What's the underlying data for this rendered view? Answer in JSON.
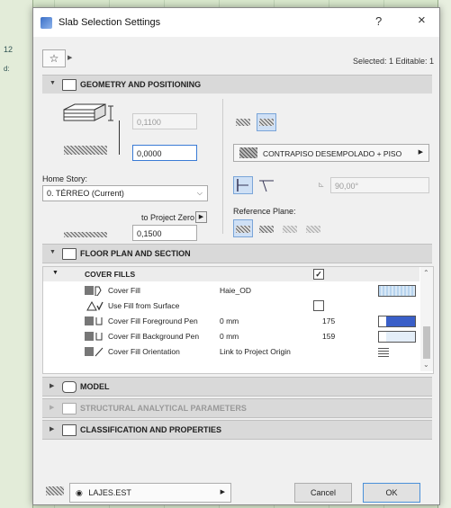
{
  "window": {
    "title": "Slab Selection Settings",
    "help": "?",
    "close": "×"
  },
  "toolbar": {
    "selected_text": "Selected: 1 Editable: 1"
  },
  "sections": {
    "geometry": "GEOMETRY AND POSITIONING",
    "floorplan": "FLOOR PLAN AND SECTION",
    "model": "MODEL",
    "structural": "STRUCTURAL ANALYTICAL PARAMETERS",
    "classification": "CLASSIFICATION AND PROPERTIES"
  },
  "geometry": {
    "thickness": "0,1100",
    "offset": "0,0000",
    "home_story_label": "Home Story:",
    "home_story": "0. TÉRREO (Current)",
    "to_project_zero_label": "to Project Zero",
    "project_zero_value": "0,1500",
    "material": "CONTRAPISO DESEMPOLADO + PISO",
    "angle": "90,00°",
    "reference_plane_label": "Reference Plane:"
  },
  "cover_fills": {
    "header": "COVER FILLS",
    "rows": [
      {
        "name": "Cover Fill",
        "value": "Haie_OD",
        "pen": ""
      },
      {
        "name": "Use Fill from Surface",
        "value": "",
        "pen": ""
      },
      {
        "name": "Cover Fill Foreground Pen",
        "value": "0 mm",
        "pen": "175"
      },
      {
        "name": "Cover Fill Background Pen",
        "value": "0 mm",
        "pen": "159"
      },
      {
        "name": "Cover Fill Orientation",
        "value": "Link to Project Origin",
        "pen": ""
      }
    ]
  },
  "footer": {
    "layer": "LAJES.EST",
    "cancel": "Cancel",
    "ok": "OK"
  },
  "background": {
    "label_12": "12",
    "label_d": "d:"
  }
}
